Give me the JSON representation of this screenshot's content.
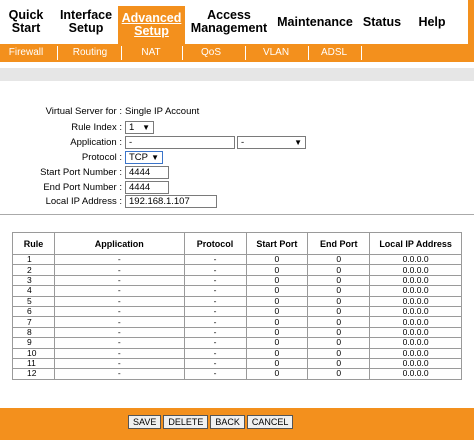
{
  "nav": {
    "items": [
      {
        "label": "Quick Start"
      },
      {
        "label": "Interface Setup"
      },
      {
        "label": "Advanced Setup",
        "active": true
      },
      {
        "label": "Access Management"
      },
      {
        "label": "Maintenance"
      },
      {
        "label": "Status"
      },
      {
        "label": "Help"
      }
    ]
  },
  "subnav": {
    "items": [
      "Firewall",
      "Routing",
      "NAT",
      "QoS",
      "VLAN",
      "ADSL"
    ]
  },
  "form": {
    "virtual_server_label": "Virtual Server for :",
    "virtual_server_value": "Single IP Account",
    "rule_index_label": "Rule Index :",
    "rule_index_value": "1",
    "application_label": "Application :",
    "application_value": "-",
    "application_select_value": "-",
    "protocol_label": "Protocol :",
    "protocol_value": "TCP",
    "start_port_label": "Start Port Number :",
    "start_port_value": "4444",
    "end_port_label": "End Port Number :",
    "end_port_value": "4444",
    "local_ip_label": "Local IP Address :",
    "local_ip_value": "192.168.1.107"
  },
  "table": {
    "headers": [
      "Rule",
      "Application",
      "Protocol",
      "Start Port",
      "End Port",
      "Local IP Address"
    ],
    "rows": [
      [
        "1",
        "-",
        "-",
        "0",
        "0",
        "0.0.0.0"
      ],
      [
        "2",
        "-",
        "-",
        "0",
        "0",
        "0.0.0.0"
      ],
      [
        "3",
        "-",
        "-",
        "0",
        "0",
        "0.0.0.0"
      ],
      [
        "4",
        "-",
        "-",
        "0",
        "0",
        "0.0.0.0"
      ],
      [
        "5",
        "-",
        "-",
        "0",
        "0",
        "0.0.0.0"
      ],
      [
        "6",
        "-",
        "-",
        "0",
        "0",
        "0.0.0.0"
      ],
      [
        "7",
        "-",
        "-",
        "0",
        "0",
        "0.0.0.0"
      ],
      [
        "8",
        "-",
        "-",
        "0",
        "0",
        "0.0.0.0"
      ],
      [
        "9",
        "-",
        "-",
        "0",
        "0",
        "0.0.0.0"
      ],
      [
        "10",
        "-",
        "-",
        "0",
        "0",
        "0.0.0.0"
      ],
      [
        "11",
        "-",
        "-",
        "0",
        "0",
        "0.0.0.0"
      ],
      [
        "12",
        "-",
        "-",
        "0",
        "0",
        "0.0.0.0"
      ]
    ]
  },
  "buttons": {
    "save": "SAVE",
    "delete": "DELETE",
    "back": "BACK",
    "cancel": "CANCEL"
  },
  "colors": {
    "accent": "#f3901d",
    "band": "#e6e6e6"
  }
}
